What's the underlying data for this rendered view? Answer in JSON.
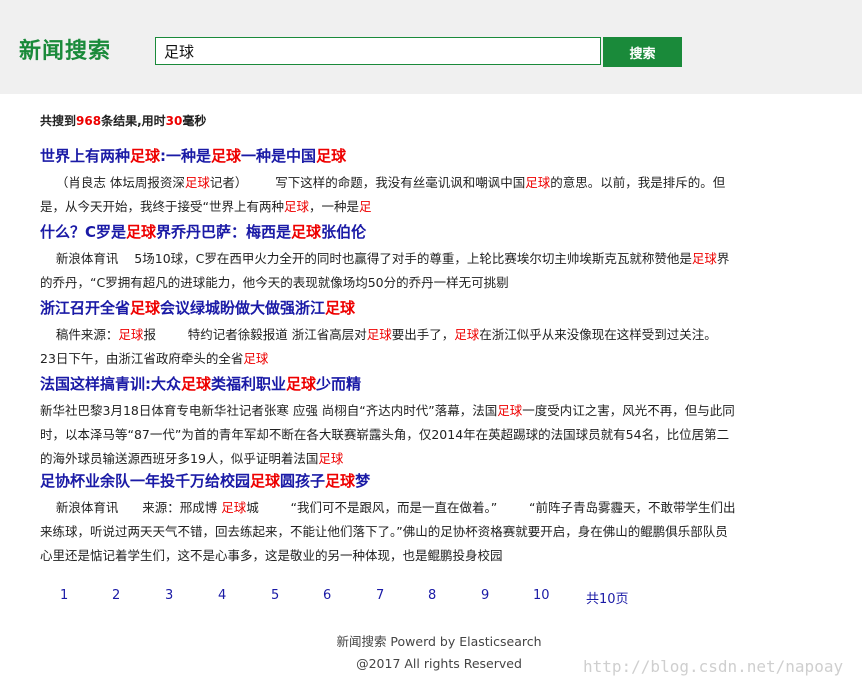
{
  "header": {
    "logo_text": "新闻搜索",
    "search_value": "足球",
    "search_button_label": "搜索"
  },
  "summary": {
    "prefix": "共搜到",
    "count": "968",
    "middle": "条结果,用时",
    "time": "30",
    "suffix": "毫秒"
  },
  "results": [
    {
      "title": [
        [
          "世界上有两种",
          false
        ],
        [
          "足球",
          true
        ],
        [
          ":一种是",
          false
        ],
        [
          "足球",
          true
        ],
        [
          "一种是中国",
          false
        ],
        [
          "足球",
          true
        ]
      ],
      "snippet": [
        [
          "    （肖良志 体坛周报资深",
          false
        ],
        [
          "足球",
          true
        ],
        [
          "记者）       写下这样的命题，我没有丝毫讥讽和嘲讽中国",
          false
        ],
        [
          "足球",
          true
        ],
        [
          "的意思。以前，我是排斥的。但是，从今天开始，我终于接受“世界上有两种",
          false
        ],
        [
          "足球",
          true
        ],
        [
          "，一种是",
          false
        ],
        [
          "足",
          true
        ]
      ]
    },
    {
      "title": [
        [
          "什么？C罗是",
          false
        ],
        [
          "足球",
          true
        ],
        [
          "界乔丹巴萨：梅西是",
          false
        ],
        [
          "足球",
          true
        ],
        [
          "张伯伦",
          false
        ]
      ],
      "snippet": [
        [
          "    新浪体育讯    5场10球，C罗在西甲火力全开的同时也赢得了对手的尊重，上轮比赛埃尔切主帅埃斯克瓦就称赞他是",
          false
        ],
        [
          "足球",
          true
        ],
        [
          "界的乔丹，“C罗拥有超凡的进球能力，他今天的表现就像场均50分的乔丹一样无可挑剔",
          false
        ]
      ]
    },
    {
      "title": [
        [
          "浙江召开全省",
          false
        ],
        [
          "足球",
          true
        ],
        [
          "会议绿城盼做大做强浙江",
          false
        ],
        [
          "足球",
          true
        ]
      ],
      "snippet": [
        [
          "    稿件来源：",
          false
        ],
        [
          "足球",
          true
        ],
        [
          "报        特约记者徐毅报道 浙江省高层对",
          false
        ],
        [
          "足球",
          true
        ],
        [
          "要出手了，",
          false
        ],
        [
          "足球",
          true
        ],
        [
          "在浙江似乎从来没像现在这样受到过关注。      23日下午，由浙江省政府牵头的全省",
          false
        ],
        [
          "足球",
          true
        ]
      ]
    },
    {
      "title": [
        [
          "法国这样搞青训:大众",
          false
        ],
        [
          "足球",
          true
        ],
        [
          "类福利职业",
          false
        ],
        [
          "足球",
          true
        ],
        [
          "少而精",
          false
        ]
      ],
      "snippet": [
        [
          "新华社巴黎3月18日体育专电新华社记者张寒 应强 尚栩自“齐达内时代”落幕，法国",
          false
        ],
        [
          "足球",
          true
        ],
        [
          "一度受内讧之害，风光不再，但与此同时，以本泽马等“87一代”为首的青年军却不断在各大联赛崭露头角，仅2014年在英超踢球的法国球员就有54名，比位居第二的海外球员输送源西班牙多19人，似乎证明着法国",
          false
        ],
        [
          "足球",
          true
        ]
      ]
    },
    {
      "title": [
        [
          "足协杯业余队一年投千万给校园",
          false
        ],
        [
          "足球",
          true
        ],
        [
          "圆孩子",
          false
        ],
        [
          "足球",
          true
        ],
        [
          "梦",
          false
        ]
      ],
      "snippet": [
        [
          "    新浪体育讯      来源：邢成博 ",
          false
        ],
        [
          "足球",
          true
        ],
        [
          "城        “我们可不是跟风，而是一直在做着。”        “前阵子青岛雾霾天，不敢带学生们出来练球，听说过两天天气不错，回去练起来，不能让他们落下了。”佛山的足协杯资格赛就要开启，身在佛山的鲲鹏俱乐部队员心里还是惦记着学生们，这不是心事多，这是敬业的另一种体现，也是鲲鹏投身校园",
          false
        ]
      ]
    }
  ],
  "pager": {
    "pages": [
      "1",
      "2",
      "3",
      "4",
      "5",
      "6",
      "7",
      "8",
      "9",
      "10"
    ],
    "total": "共10页"
  },
  "footer": {
    "line1": "新闻搜索 Powerd by Elasticsearch",
    "line2": "@2017 All rights Reserved"
  },
  "watermark": "http://blog.csdn.net/napoay",
  "colors": {
    "brand_green": "#1a8a3a",
    "link_blue": "#1a1aa6",
    "highlight_red": "#e00000"
  }
}
